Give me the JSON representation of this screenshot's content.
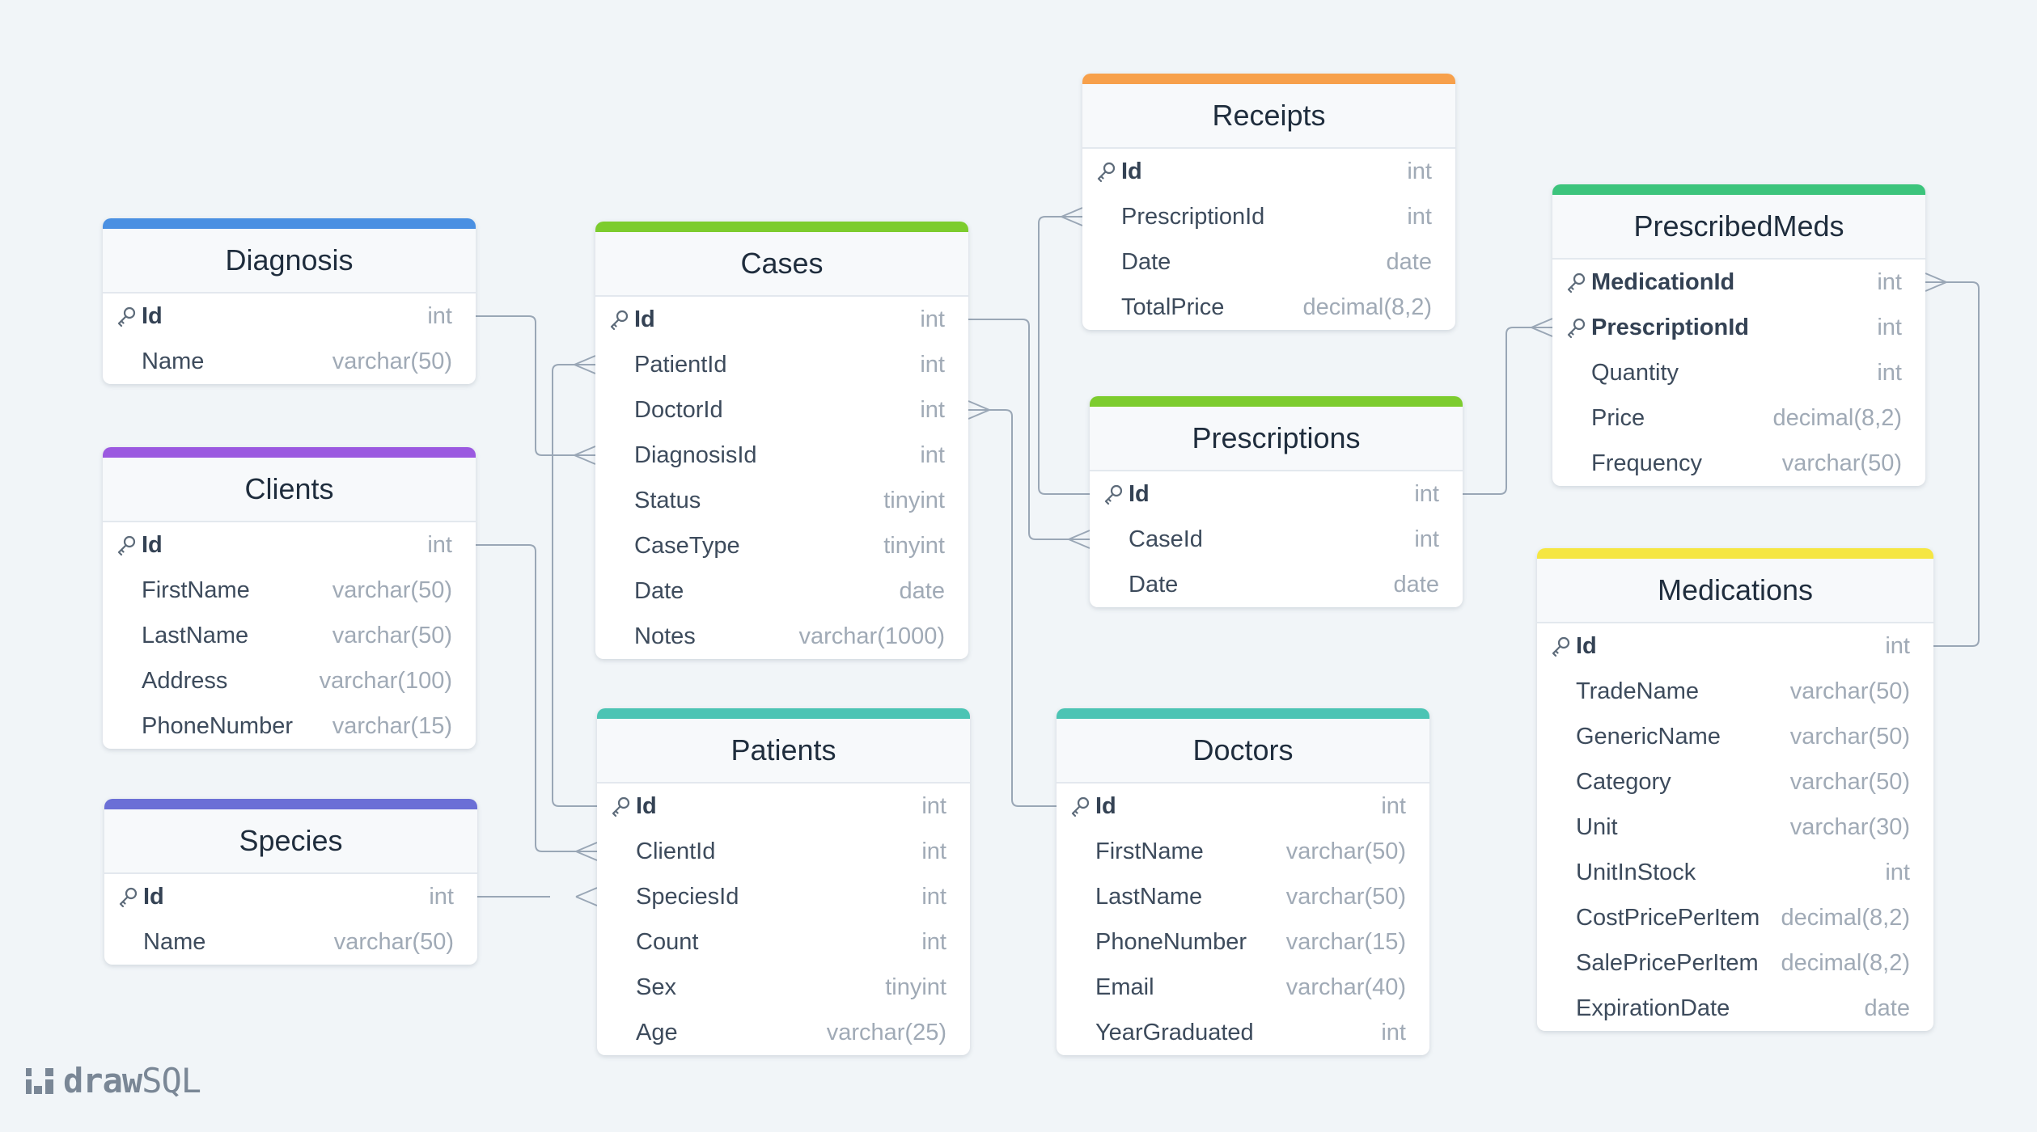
{
  "brand": {
    "word_a": "draw",
    "word_b": "SQL"
  },
  "icons": {
    "key": "key-icon",
    "logo": "drawsql-logo-icon"
  },
  "tables": [
    {
      "id": "diagnosis",
      "name": "Diagnosis",
      "color": "#4a90e2",
      "columns": [
        {
          "name": "Id",
          "type": "int",
          "pk": true
        },
        {
          "name": "Name",
          "type": "varchar(50)"
        }
      ]
    },
    {
      "id": "clients",
      "name": "Clients",
      "color": "#9b59e0",
      "columns": [
        {
          "name": "Id",
          "type": "int",
          "pk": true
        },
        {
          "name": "FirstName",
          "type": "varchar(50)"
        },
        {
          "name": "LastName",
          "type": "varchar(50)"
        },
        {
          "name": "Address",
          "type": "varchar(100)"
        },
        {
          "name": "PhoneNumber",
          "type": "varchar(15)"
        }
      ]
    },
    {
      "id": "species",
      "name": "Species",
      "color": "#6b6fd6",
      "columns": [
        {
          "name": "Id",
          "type": "int",
          "pk": true
        },
        {
          "name": "Name",
          "type": "varchar(50)"
        }
      ]
    },
    {
      "id": "cases",
      "name": "Cases",
      "color": "#7dcc2e",
      "columns": [
        {
          "name": "Id",
          "type": "int",
          "pk": true
        },
        {
          "name": "PatientId",
          "type": "int"
        },
        {
          "name": "DoctorId",
          "type": "int"
        },
        {
          "name": "DiagnosisId",
          "type": "int"
        },
        {
          "name": "Status",
          "type": "tinyint"
        },
        {
          "name": "CaseType",
          "type": "tinyint"
        },
        {
          "name": "Date",
          "type": "date"
        },
        {
          "name": "Notes",
          "type": "varchar(1000)"
        }
      ]
    },
    {
      "id": "patients",
      "name": "Patients",
      "color": "#4cc4b4",
      "columns": [
        {
          "name": "Id",
          "type": "int",
          "pk": true
        },
        {
          "name": "ClientId",
          "type": "int"
        },
        {
          "name": "SpeciesId",
          "type": "int"
        },
        {
          "name": "Count",
          "type": "int"
        },
        {
          "name": "Sex",
          "type": "tinyint"
        },
        {
          "name": "Age",
          "type": "varchar(25)"
        }
      ]
    },
    {
      "id": "receipts",
      "name": "Receipts",
      "color": "#f7a04b",
      "columns": [
        {
          "name": "Id",
          "type": "int",
          "pk": true
        },
        {
          "name": "PrescriptionId",
          "type": "int"
        },
        {
          "name": "Date",
          "type": "date"
        },
        {
          "name": "TotalPrice",
          "type": "decimal(8,2)"
        }
      ]
    },
    {
      "id": "prescriptions",
      "name": "Prescriptions",
      "color": "#7dcc2e",
      "columns": [
        {
          "name": "Id",
          "type": "int",
          "pk": true
        },
        {
          "name": "CaseId",
          "type": "int"
        },
        {
          "name": "Date",
          "type": "date"
        }
      ]
    },
    {
      "id": "doctors",
      "name": "Doctors",
      "color": "#4cc4b4",
      "columns": [
        {
          "name": "Id",
          "type": "int",
          "pk": true
        },
        {
          "name": "FirstName",
          "type": "varchar(50)"
        },
        {
          "name": "LastName",
          "type": "varchar(50)"
        },
        {
          "name": "PhoneNumber",
          "type": "varchar(15)"
        },
        {
          "name": "Email",
          "type": "varchar(40)"
        },
        {
          "name": "YearGraduated",
          "type": "int"
        }
      ]
    },
    {
      "id": "prescribedmeds",
      "name": "PrescribedMeds",
      "color": "#3cc47c",
      "columns": [
        {
          "name": "MedicationId",
          "type": "int",
          "pk": true
        },
        {
          "name": "PrescriptionId",
          "type": "int",
          "pk": true
        },
        {
          "name": "Quantity",
          "type": "int"
        },
        {
          "name": "Price",
          "type": "decimal(8,2)"
        },
        {
          "name": "Frequency",
          "type": "varchar(50)"
        }
      ]
    },
    {
      "id": "medications",
      "name": "Medications",
      "color": "#f5e642",
      "columns": [
        {
          "name": "Id",
          "type": "int",
          "pk": true
        },
        {
          "name": "TradeName",
          "type": "varchar(50)"
        },
        {
          "name": "GenericName",
          "type": "varchar(50)"
        },
        {
          "name": "Category",
          "type": "varchar(50)"
        },
        {
          "name": "Unit",
          "type": "varchar(30)"
        },
        {
          "name": "UnitInStock",
          "type": "int"
        },
        {
          "name": "CostPricePerItem",
          "type": "decimal(8,2)"
        },
        {
          "name": "SalePricePerItem",
          "type": "decimal(8,2)"
        },
        {
          "name": "ExpirationDate",
          "type": "date"
        }
      ]
    }
  ],
  "relations": [
    {
      "from": "diagnosis.Id",
      "to": "cases.DiagnosisId"
    },
    {
      "from": "patients.Id",
      "to": "cases.PatientId"
    },
    {
      "from": "doctors.Id",
      "to": "cases.DoctorId"
    },
    {
      "from": "clients.Id",
      "to": "patients.ClientId"
    },
    {
      "from": "species.Id",
      "to": "patients.SpeciesId"
    },
    {
      "from": "cases.Id",
      "to": "prescriptions.CaseId"
    },
    {
      "from": "prescriptions.Id",
      "to": "receipts.PrescriptionId"
    },
    {
      "from": "prescriptions.Id",
      "to": "prescribedmeds.PrescriptionId"
    },
    {
      "from": "medications.Id",
      "to": "prescribedmeds.MedicationId"
    }
  ]
}
